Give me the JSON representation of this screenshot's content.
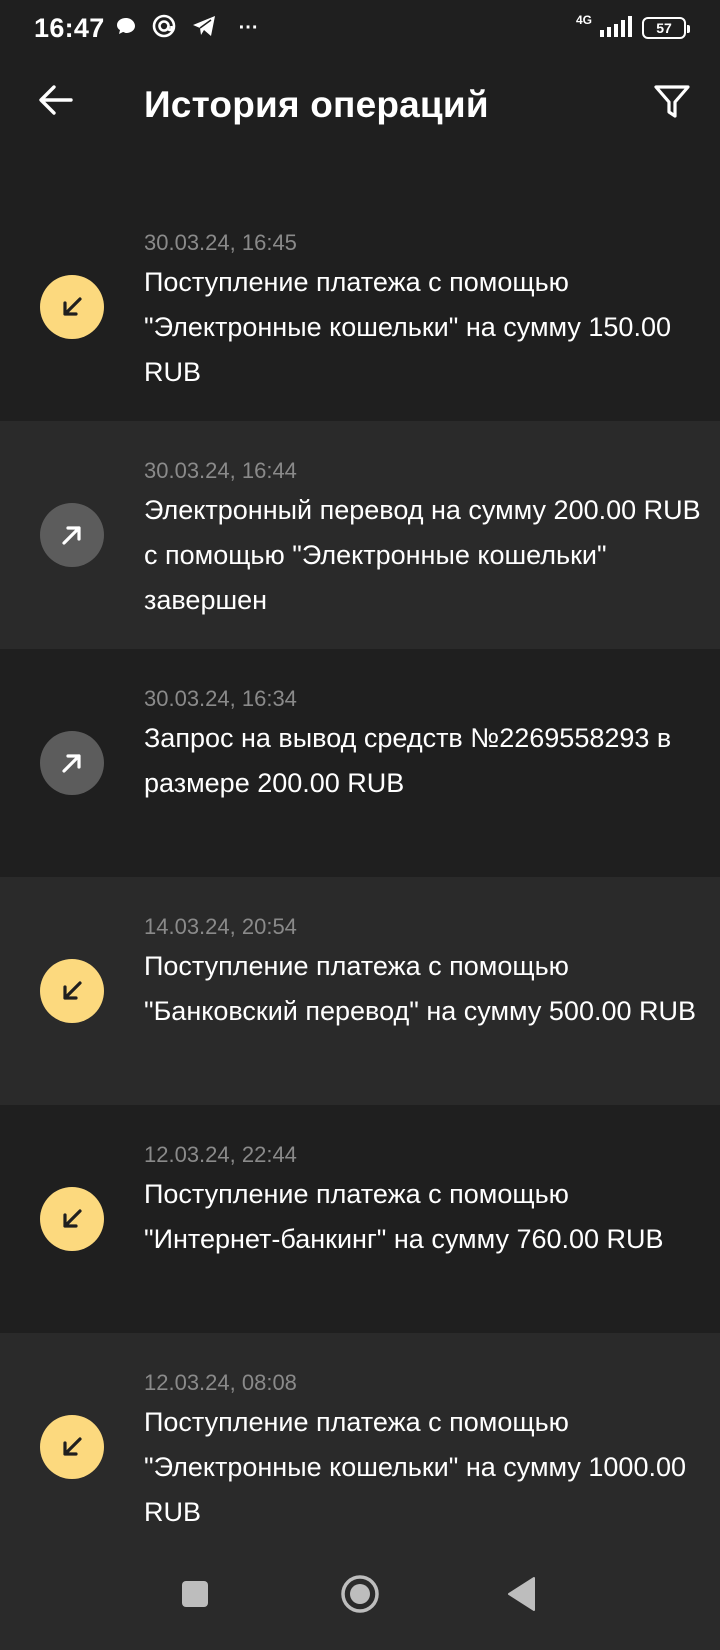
{
  "status_bar": {
    "time": "16:47",
    "network": "4G",
    "battery": "57",
    "more": "···"
  },
  "app_bar": {
    "title": "История операций"
  },
  "transactions": [
    {
      "direction": "in",
      "date": "30.03.24, 16:45",
      "description": "Поступление платежа с помощью \"Электронные кошельки\" на сумму 150.00 RUB"
    },
    {
      "direction": "out",
      "date": "30.03.24, 16:44",
      "description": "Электронный перевод на сумму 200.00 RUB с помощью \"Электронные кошельки\" завершен"
    },
    {
      "direction": "out",
      "date": "30.03.24, 16:34",
      "description": "Запрос на вывод средств №2269558293 в размере 200.00 RUB"
    },
    {
      "direction": "in",
      "date": "14.03.24, 20:54",
      "description": "Поступление платежа с помощью \"Банковский перевод\" на сумму 500.00 RUB"
    },
    {
      "direction": "in",
      "date": "12.03.24, 22:44",
      "description": "Поступление платежа с помощью \"Интернет-банкинг\" на сумму 760.00 RUB"
    },
    {
      "direction": "in",
      "date": "12.03.24, 08:08",
      "description": "Поступление платежа с помощью \"Электронные кошельки\" на сумму 1000.00 RUB"
    }
  ],
  "colors": {
    "background": "#1f1f1f",
    "row_alt": "#2a2a2a",
    "incoming_accent": "#fcd97e",
    "outgoing_accent": "#5c5c5c",
    "date_text": "#8a8a8a"
  },
  "icons": {
    "incoming": "arrow-down-left-icon",
    "outgoing": "arrow-up-right-icon",
    "back": "arrow-left-icon",
    "filter": "filter-icon"
  }
}
